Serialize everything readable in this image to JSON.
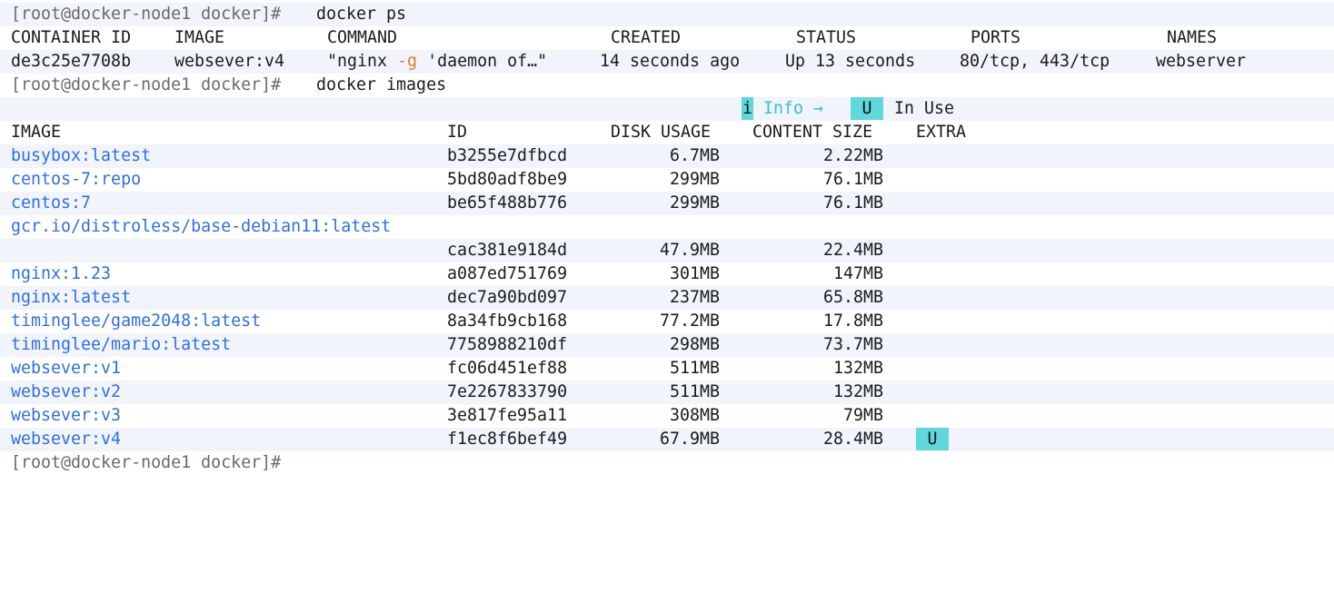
{
  "prompt": "[root@docker-node1 docker]#",
  "commands": {
    "ps": "docker ps",
    "images": "docker images"
  },
  "ps": {
    "headers": [
      "CONTAINER ID",
      "IMAGE",
      "COMMAND",
      "CREATED",
      "STATUS",
      "PORTS",
      "NAMES"
    ],
    "row": {
      "container_id": "de3c25e7708b",
      "image": "websever:v4",
      "command_pre": "\"nginx ",
      "command_flag": "-g",
      "command_post": " 'daemon of…\"",
      "created": "14 seconds ago",
      "status": "Up 13 seconds",
      "ports": "80/tcp, 443/tcp",
      "names": "webserver"
    }
  },
  "legend": {
    "info_icon": "i",
    "info_label": "Info →",
    "badge": "U",
    "badge_label": "In Use"
  },
  "images": {
    "headers": [
      "IMAGE",
      "ID",
      "DISK USAGE",
      "CONTENT SIZE",
      "EXTRA"
    ],
    "rows": [
      {
        "image": "busybox:latest",
        "id": "b3255e7dfbcd",
        "disk": "6.7MB",
        "content": "2.22MB",
        "extra": ""
      },
      {
        "image": "centos-7:repo",
        "id": "5bd80adf8be9",
        "disk": "299MB",
        "content": "76.1MB",
        "extra": ""
      },
      {
        "image": "centos:7",
        "id": "be65f488b776",
        "disk": "299MB",
        "content": "76.1MB",
        "extra": ""
      },
      {
        "image": "gcr.io/distroless/base-debian11:latest",
        "id": "",
        "disk": "",
        "content": "",
        "extra": ""
      },
      {
        "image": "",
        "id": "cac381e9184d",
        "disk": "47.9MB",
        "content": "22.4MB",
        "extra": ""
      },
      {
        "image": "nginx:1.23",
        "id": "a087ed751769",
        "disk": "301MB",
        "content": "147MB",
        "extra": ""
      },
      {
        "image": "nginx:latest",
        "id": "dec7a90bd097",
        "disk": "237MB",
        "content": "65.8MB",
        "extra": ""
      },
      {
        "image": "timinglee/game2048:latest",
        "id": "8a34fb9cb168",
        "disk": "77.2MB",
        "content": "17.8MB",
        "extra": ""
      },
      {
        "image": "timinglee/mario:latest",
        "id": "7758988210df",
        "disk": "298MB",
        "content": "73.7MB",
        "extra": ""
      },
      {
        "image": "websever:v1",
        "id": "fc06d451ef88",
        "disk": "511MB",
        "content": "132MB",
        "extra": ""
      },
      {
        "image": "websever:v2",
        "id": "7e2267833790",
        "disk": "511MB",
        "content": "132MB",
        "extra": ""
      },
      {
        "image": "websever:v3",
        "id": "3e817fe95a11",
        "disk": "308MB",
        "content": "79MB",
        "extra": ""
      },
      {
        "image": "websever:v4",
        "id": "f1ec8f6bef49",
        "disk": "67.9MB",
        "content": "28.4MB",
        "extra": "U"
      }
    ]
  },
  "colors": {
    "prompt": "#6a6a6a",
    "image_name": "#2f6fe0",
    "flag": "#e07b2b",
    "badge_bg": "#5fd8dc",
    "row_shade": "#f1f4fa"
  }
}
